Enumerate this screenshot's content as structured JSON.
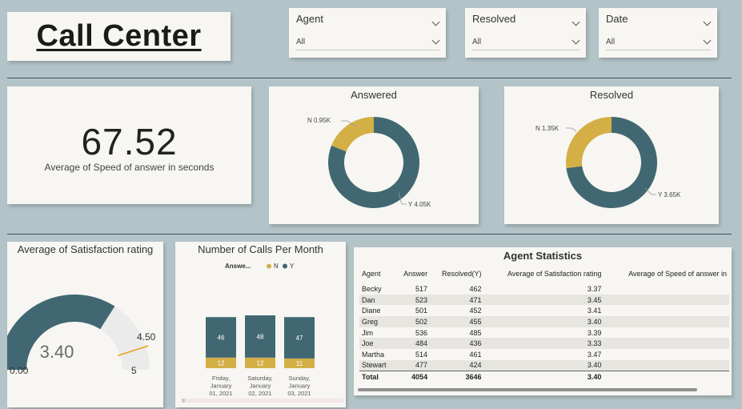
{
  "title": "Call Center",
  "slicers": [
    {
      "label": "Agent",
      "value": "All"
    },
    {
      "label": "Resolved",
      "value": "All"
    },
    {
      "label": "Date",
      "value": "All"
    }
  ],
  "kpi": {
    "value": "67.52",
    "caption": "Average of Speed of answer in seconds"
  },
  "answered": {
    "title": "Answered",
    "n_label": "N 0.95K",
    "y_label": "Y 4.05K",
    "chart_data": {
      "type": "pie",
      "labels": [
        "N",
        "Y"
      ],
      "values": [
        0.95,
        4.05
      ],
      "unit": "K",
      "colors": [
        "#d4af46",
        "#416872"
      ]
    }
  },
  "resolved": {
    "title": "Resolved",
    "n_label": "N 1.35K",
    "y_label": "Y 3.65K",
    "chart_data": {
      "type": "pie",
      "labels": [
        "N",
        "Y"
      ],
      "values": [
        1.35,
        3.65
      ],
      "unit": "K",
      "colors": [
        "#d4af46",
        "#416872"
      ]
    }
  },
  "gauge": {
    "title": "Average of Satisfaction rating",
    "value": 3.4,
    "value_label": "3.40",
    "min_label": "0.00",
    "max_label": "5",
    "target_label": "4.50",
    "min": 0,
    "max": 5,
    "target": 4.5,
    "colors": {
      "fill": "#416872",
      "track": "#ebebeb",
      "target": "#e8a21c"
    }
  },
  "calls": {
    "title": "Number of Calls Per Month",
    "legend_title": "Answe...",
    "legend": [
      {
        "name": "N",
        "color": "#d4af46"
      },
      {
        "name": "Y",
        "color": "#416872"
      }
    ],
    "chart_data": {
      "type": "bar",
      "stacked": true,
      "categories": [
        [
          "Friday,",
          "January",
          "01, 2021"
        ],
        [
          "Saturday,",
          "January",
          "02, 2021"
        ],
        [
          "Sunday,",
          "January",
          "03, 2021"
        ]
      ],
      "series": [
        {
          "name": "N",
          "values": [
            12,
            12,
            11
          ]
        },
        {
          "name": "Y",
          "values": [
            46,
            48,
            47
          ]
        }
      ]
    }
  },
  "agent_stats": {
    "title": "Agent Statistics",
    "columns": [
      "Agent",
      "Answer",
      "Resolved(Y)",
      "Average of Satisfaction rating",
      "Average of Speed of answer in"
    ],
    "rows": [
      [
        "Becky",
        "517",
        "462",
        "3.37"
      ],
      [
        "Dan",
        "523",
        "471",
        "3.45"
      ],
      [
        "Diane",
        "501",
        "452",
        "3.41"
      ],
      [
        "Greg",
        "502",
        "455",
        "3.40"
      ],
      [
        "Jim",
        "536",
        "485",
        "3.39"
      ],
      [
        "Joe",
        "484",
        "436",
        "3.33"
      ],
      [
        "Martha",
        "514",
        "461",
        "3.47"
      ],
      [
        "Stewart",
        "477",
        "424",
        "3.40"
      ]
    ],
    "total": [
      "Total",
      "4054",
      "3646",
      "3.40"
    ]
  }
}
